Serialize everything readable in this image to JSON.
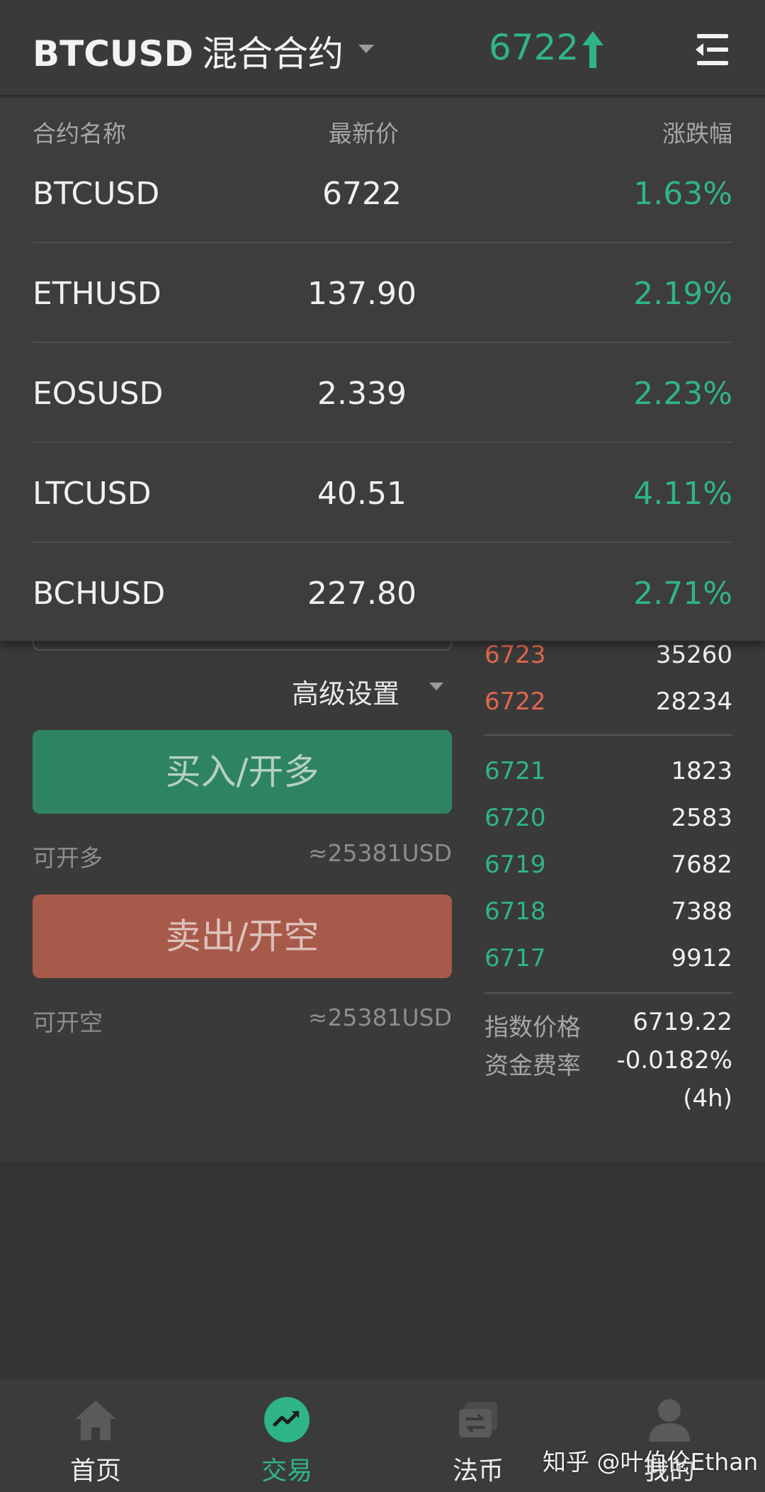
{
  "header": {
    "symbol": "BTCUSD",
    "contract_type": "混合合约",
    "last_price": "6722",
    "price_color": "#2fb585"
  },
  "contract_list": {
    "columns": {
      "name": "合约名称",
      "price": "最新价",
      "change": "涨跌幅"
    },
    "rows": [
      {
        "name": "BTCUSD",
        "price": "6722",
        "change": "1.63%"
      },
      {
        "name": "ETHUSD",
        "price": "137.90",
        "change": "2.19%"
      },
      {
        "name": "EOSUSD",
        "price": "2.339",
        "change": "2.23%"
      },
      {
        "name": "LTCUSD",
        "price": "40.51",
        "change": "4.11%"
      },
      {
        "name": "BCHUSD",
        "price": "227.80",
        "change": "2.71%"
      }
    ]
  },
  "trade": {
    "advanced_settings": "高级设置",
    "buy_label": "买入/开多",
    "buy_avail_label": "可开多",
    "buy_avail_value": "≈25381USD",
    "sell_label": "卖出/开空",
    "sell_avail_label": "可开空",
    "sell_avail_value": "≈25381USD"
  },
  "orderbook": {
    "asks": [
      {
        "price": "6723",
        "qty": "35260"
      },
      {
        "price": "6722",
        "qty": "28234"
      }
    ],
    "bids": [
      {
        "price": "6721",
        "qty": "1823"
      },
      {
        "price": "6720",
        "qty": "2583"
      },
      {
        "price": "6719",
        "qty": "7682"
      },
      {
        "price": "6718",
        "qty": "7388"
      },
      {
        "price": "6717",
        "qty": "9912"
      }
    ],
    "index_label": "指数价格",
    "index_value": "6719.22",
    "funding_label": "资金费率",
    "funding_value": "-0.0182%",
    "funding_period": "(4h)"
  },
  "nav": {
    "items": [
      {
        "label": "首页",
        "icon": "home-icon"
      },
      {
        "label": "交易",
        "icon": "trade-icon"
      },
      {
        "label": "法币",
        "icon": "fiat-icon"
      },
      {
        "label": "我的",
        "icon": "profile-icon"
      }
    ],
    "active_color": "#2fb585"
  },
  "watermark": "知乎 @叶伯伦Ethan"
}
